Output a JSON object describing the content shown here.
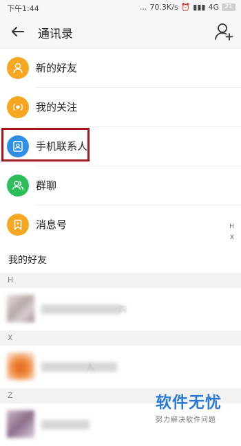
{
  "status_bar": {
    "time": "下午1:44",
    "net_speed": "70.3K/s",
    "signal": "4G",
    "battery": "21"
  },
  "header": {
    "title": "通讯录"
  },
  "menu": {
    "items": [
      {
        "label": "新的好友",
        "icon": "person-icon",
        "color": "#f5a623"
      },
      {
        "label": "我的关注",
        "icon": "broadcast-icon",
        "color": "#f5a623"
      },
      {
        "label": "手机联系人",
        "icon": "contact-card-icon",
        "color": "#2f8fe8"
      },
      {
        "label": "群聊",
        "icon": "group-icon",
        "color": "#2dbd5b"
      },
      {
        "label": "消息号",
        "icon": "bookmark-icon",
        "color": "#f5a623"
      }
    ],
    "highlight_color": "#a6151c"
  },
  "index_letters": [
    "H",
    "X",
    "Z"
  ],
  "friends": {
    "title": "我的好友",
    "groups": [
      {
        "letter": "H",
        "name_fragment": "购"
      },
      {
        "letter": "X",
        "name_fragment": "人"
      },
      {
        "letter": "Z",
        "name_fragment": ""
      }
    ]
  },
  "watermark": {
    "title": "软件无忧",
    "subtitle": "努力解决软件问题"
  }
}
